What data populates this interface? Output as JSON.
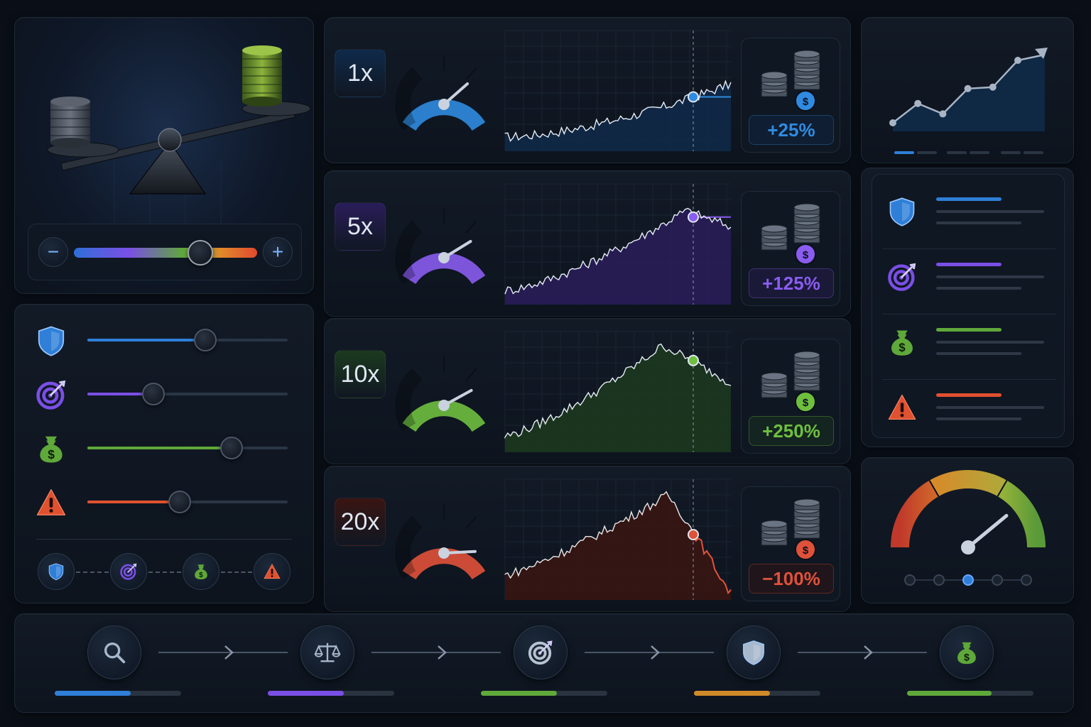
{
  "levels": [
    {
      "label": "1x",
      "change": "+25%",
      "color": "#2f8be0",
      "chart_fill": "#0f2a4a"
    },
    {
      "label": "5x",
      "change": "+125%",
      "color": "#8a5cf0",
      "chart_fill": "#2a1d5a"
    },
    {
      "label": "10x",
      "change": "+250%",
      "color": "#6fbf3f",
      "chart_fill": "#1c3a1f"
    },
    {
      "label": "20x",
      "change": "−100%",
      "color": "#e0513a",
      "chart_fill": "#3a1512"
    }
  ],
  "balance_slider": {
    "minus_label": "−",
    "plus_label": "+",
    "value": 0.69
  },
  "risk_sliders": [
    {
      "icon": "shield-icon",
      "color": "#2f7fd8",
      "value": 0.59
    },
    {
      "icon": "target-icon",
      "color": "#7a4fe6",
      "value": 0.33
    },
    {
      "icon": "money-bag-icon",
      "color": "#5fa83a",
      "value": 0.72
    },
    {
      "icon": "warning-icon",
      "color": "#e0512f",
      "value": 0.46
    }
  ],
  "legend_lines": [
    {
      "icon": "shield-icon",
      "color": "#2f7fd8"
    },
    {
      "icon": "target-icon",
      "color": "#7a4fe6"
    },
    {
      "icon": "money-bag-icon",
      "color": "#5fa83a"
    },
    {
      "icon": "warning-icon",
      "color": "#e0512f"
    }
  ],
  "workflow_steps": [
    {
      "icon": "search-icon",
      "color": "#2f7fd8",
      "progress": 0.6
    },
    {
      "icon": "scale-icon",
      "color": "#7a4fe6",
      "progress": 0.6
    },
    {
      "icon": "target-icon",
      "color": "#5fa83a",
      "progress": 0.6
    },
    {
      "icon": "shield-icon",
      "color": "#d08a2a",
      "progress": 0.6
    },
    {
      "icon": "money-bag-icon",
      "color": "#5fa83a",
      "progress": 0.67
    }
  ],
  "risk_gauge": {
    "value": 0.78,
    "step_index": 2,
    "steps": 5
  },
  "trend_chart": {
    "values": [
      1,
      2.3,
      1.6,
      3.3,
      3.4,
      5.2
    ]
  }
}
